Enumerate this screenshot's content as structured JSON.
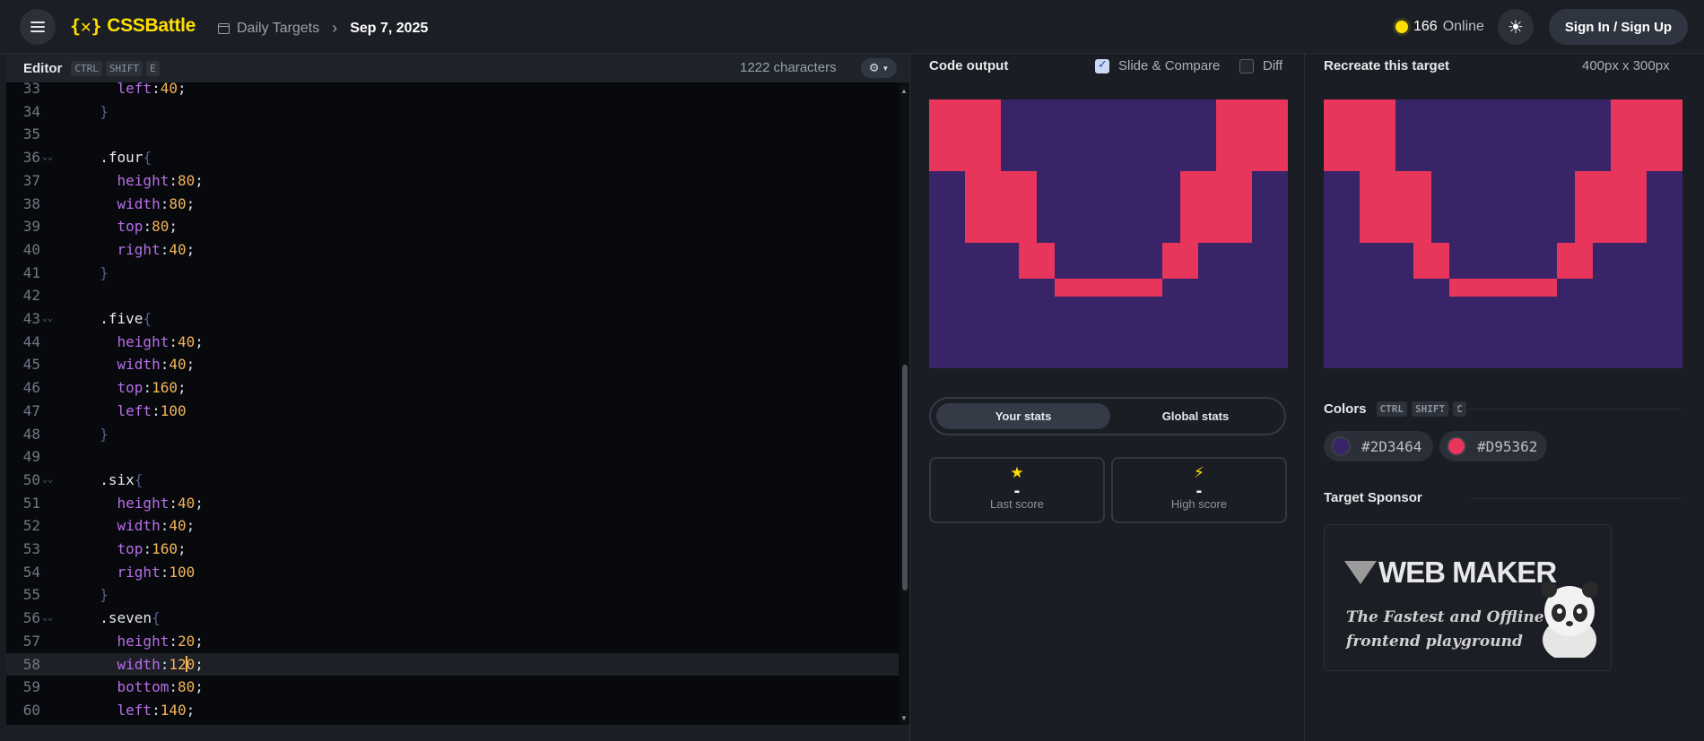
{
  "header": {
    "brand": "CSSBattle",
    "breadcrumb_section": "Daily Targets",
    "breadcrumb_date": "Sep 7, 2025",
    "online_count": "166",
    "online_label": "Online",
    "signin_label": "Sign In / Sign Up",
    "icons": {
      "menu": "menu-icon",
      "logo": "cssbattle-logo-icon",
      "calendar": "calendar-icon",
      "theme": "sun-icon",
      "online": "online-dot-icon"
    }
  },
  "editor": {
    "title": "Editor",
    "shortcut": [
      "CTRL",
      "SHIFT",
      "E"
    ],
    "char_count": "1222 characters",
    "settings_icon": "gear-icon",
    "active_line": 58,
    "lines": [
      {
        "n": "33",
        "indent": "    ",
        "tokens": [
          [
            "prop",
            "left"
          ],
          [
            "punct",
            ":"
          ],
          [
            "val",
            "40"
          ],
          [
            "punct",
            ";"
          ]
        ]
      },
      {
        "n": "34",
        "indent": "  ",
        "tokens": [
          [
            "brace",
            "}"
          ]
        ]
      },
      {
        "n": "35",
        "indent": "",
        "tokens": []
      },
      {
        "n": "36",
        "fold": true,
        "indent": "  ",
        "tokens": [
          [
            "sel",
            ".four"
          ],
          [
            "brace",
            "{"
          ]
        ]
      },
      {
        "n": "37",
        "indent": "    ",
        "tokens": [
          [
            "prop",
            "height"
          ],
          [
            "punct",
            ":"
          ],
          [
            "val",
            "80"
          ],
          [
            "punct",
            ";"
          ]
        ]
      },
      {
        "n": "38",
        "indent": "    ",
        "tokens": [
          [
            "prop",
            "width"
          ],
          [
            "punct",
            ":"
          ],
          [
            "val",
            "80"
          ],
          [
            "punct",
            ";"
          ]
        ]
      },
      {
        "n": "39",
        "indent": "    ",
        "tokens": [
          [
            "prop",
            "top"
          ],
          [
            "punct",
            ":"
          ],
          [
            "val",
            "80"
          ],
          [
            "punct",
            ";"
          ]
        ]
      },
      {
        "n": "40",
        "indent": "    ",
        "tokens": [
          [
            "prop",
            "right"
          ],
          [
            "punct",
            ":"
          ],
          [
            "val",
            "40"
          ],
          [
            "punct",
            ";"
          ]
        ]
      },
      {
        "n": "41",
        "indent": "  ",
        "tokens": [
          [
            "brace",
            "}"
          ]
        ]
      },
      {
        "n": "42",
        "indent": "",
        "tokens": []
      },
      {
        "n": "43",
        "fold": true,
        "indent": "  ",
        "tokens": [
          [
            "sel",
            ".five"
          ],
          [
            "brace",
            "{"
          ]
        ]
      },
      {
        "n": "44",
        "indent": "    ",
        "tokens": [
          [
            "prop",
            "height"
          ],
          [
            "punct",
            ":"
          ],
          [
            "val",
            "40"
          ],
          [
            "punct",
            ";"
          ]
        ]
      },
      {
        "n": "45",
        "indent": "    ",
        "tokens": [
          [
            "prop",
            "width"
          ],
          [
            "punct",
            ":"
          ],
          [
            "val",
            "40"
          ],
          [
            "punct",
            ";"
          ]
        ]
      },
      {
        "n": "46",
        "indent": "    ",
        "tokens": [
          [
            "prop",
            "top"
          ],
          [
            "punct",
            ":"
          ],
          [
            "val",
            "160"
          ],
          [
            "punct",
            ";"
          ]
        ]
      },
      {
        "n": "47",
        "indent": "    ",
        "tokens": [
          [
            "prop",
            "left"
          ],
          [
            "punct",
            ":"
          ],
          [
            "val",
            "100"
          ]
        ]
      },
      {
        "n": "48",
        "indent": "  ",
        "tokens": [
          [
            "brace",
            "}"
          ]
        ]
      },
      {
        "n": "49",
        "indent": "",
        "tokens": []
      },
      {
        "n": "50",
        "fold": true,
        "indent": "  ",
        "tokens": [
          [
            "sel",
            ".six"
          ],
          [
            "brace",
            "{"
          ]
        ]
      },
      {
        "n": "51",
        "indent": "    ",
        "tokens": [
          [
            "prop",
            "height"
          ],
          [
            "punct",
            ":"
          ],
          [
            "val",
            "40"
          ],
          [
            "punct",
            ";"
          ]
        ]
      },
      {
        "n": "52",
        "indent": "    ",
        "tokens": [
          [
            "prop",
            "width"
          ],
          [
            "punct",
            ":"
          ],
          [
            "val",
            "40"
          ],
          [
            "punct",
            ";"
          ]
        ]
      },
      {
        "n": "53",
        "indent": "    ",
        "tokens": [
          [
            "prop",
            "top"
          ],
          [
            "punct",
            ":"
          ],
          [
            "val",
            "160"
          ],
          [
            "punct",
            ";"
          ]
        ]
      },
      {
        "n": "54",
        "indent": "    ",
        "tokens": [
          [
            "prop",
            "right"
          ],
          [
            "punct",
            ":"
          ],
          [
            "val",
            "100"
          ]
        ]
      },
      {
        "n": "55",
        "indent": "  ",
        "tokens": [
          [
            "brace",
            "}"
          ]
        ]
      },
      {
        "n": "56",
        "fold": true,
        "indent": "  ",
        "tokens": [
          [
            "sel",
            ".seven"
          ],
          [
            "brace",
            "{"
          ]
        ]
      },
      {
        "n": "57",
        "indent": "    ",
        "tokens": [
          [
            "prop",
            "height"
          ],
          [
            "punct",
            ":"
          ],
          [
            "val",
            "20"
          ],
          [
            "punct",
            ";"
          ]
        ]
      },
      {
        "n": "58",
        "indent": "    ",
        "tokens": [
          [
            "prop",
            "width"
          ],
          [
            "punct",
            ":"
          ],
          [
            "val",
            "12"
          ],
          [
            "caret",
            ""
          ],
          [
            "val",
            "0"
          ],
          [
            "punct",
            ";"
          ]
        ]
      },
      {
        "n": "59",
        "indent": "    ",
        "tokens": [
          [
            "prop",
            "bottom"
          ],
          [
            "punct",
            ":"
          ],
          [
            "val",
            "80"
          ],
          [
            "punct",
            ";"
          ]
        ]
      },
      {
        "n": "60",
        "indent": "    ",
        "tokens": [
          [
            "prop",
            "left"
          ],
          [
            "punct",
            ":"
          ],
          [
            "val",
            "140"
          ],
          [
            "punct",
            ";"
          ]
        ]
      }
    ]
  },
  "output": {
    "title": "Code output",
    "slide_compare_label": "Slide & Compare",
    "slide_compare_checked": true,
    "diff_label": "Diff",
    "diff_checked": false,
    "tabs": [
      "Your stats",
      "Global stats"
    ],
    "active_tab": "Your stats",
    "stats": [
      {
        "icon": "star-icon",
        "glyph": "★",
        "value": "-",
        "label": "Last score"
      },
      {
        "icon": "lightning-icon",
        "glyph": "⚡",
        "value": "-",
        "label": "High score"
      }
    ]
  },
  "target": {
    "title": "Recreate this target",
    "dimensions": "400px x 300px",
    "colors_title": "Colors",
    "colors_shortcut": [
      "CTRL",
      "SHIFT",
      "C"
    ],
    "colors": [
      "#2D3464",
      "#D95362"
    ],
    "sponsor_title": "Target Sponsor",
    "sponsor": {
      "logo_text": "WEB MAKER",
      "tagline_1": "The Fastest and Offline",
      "tagline_2": "frontend playground"
    }
  },
  "render_colors": {
    "bg": "#392468",
    "fg": "#e7355c"
  }
}
